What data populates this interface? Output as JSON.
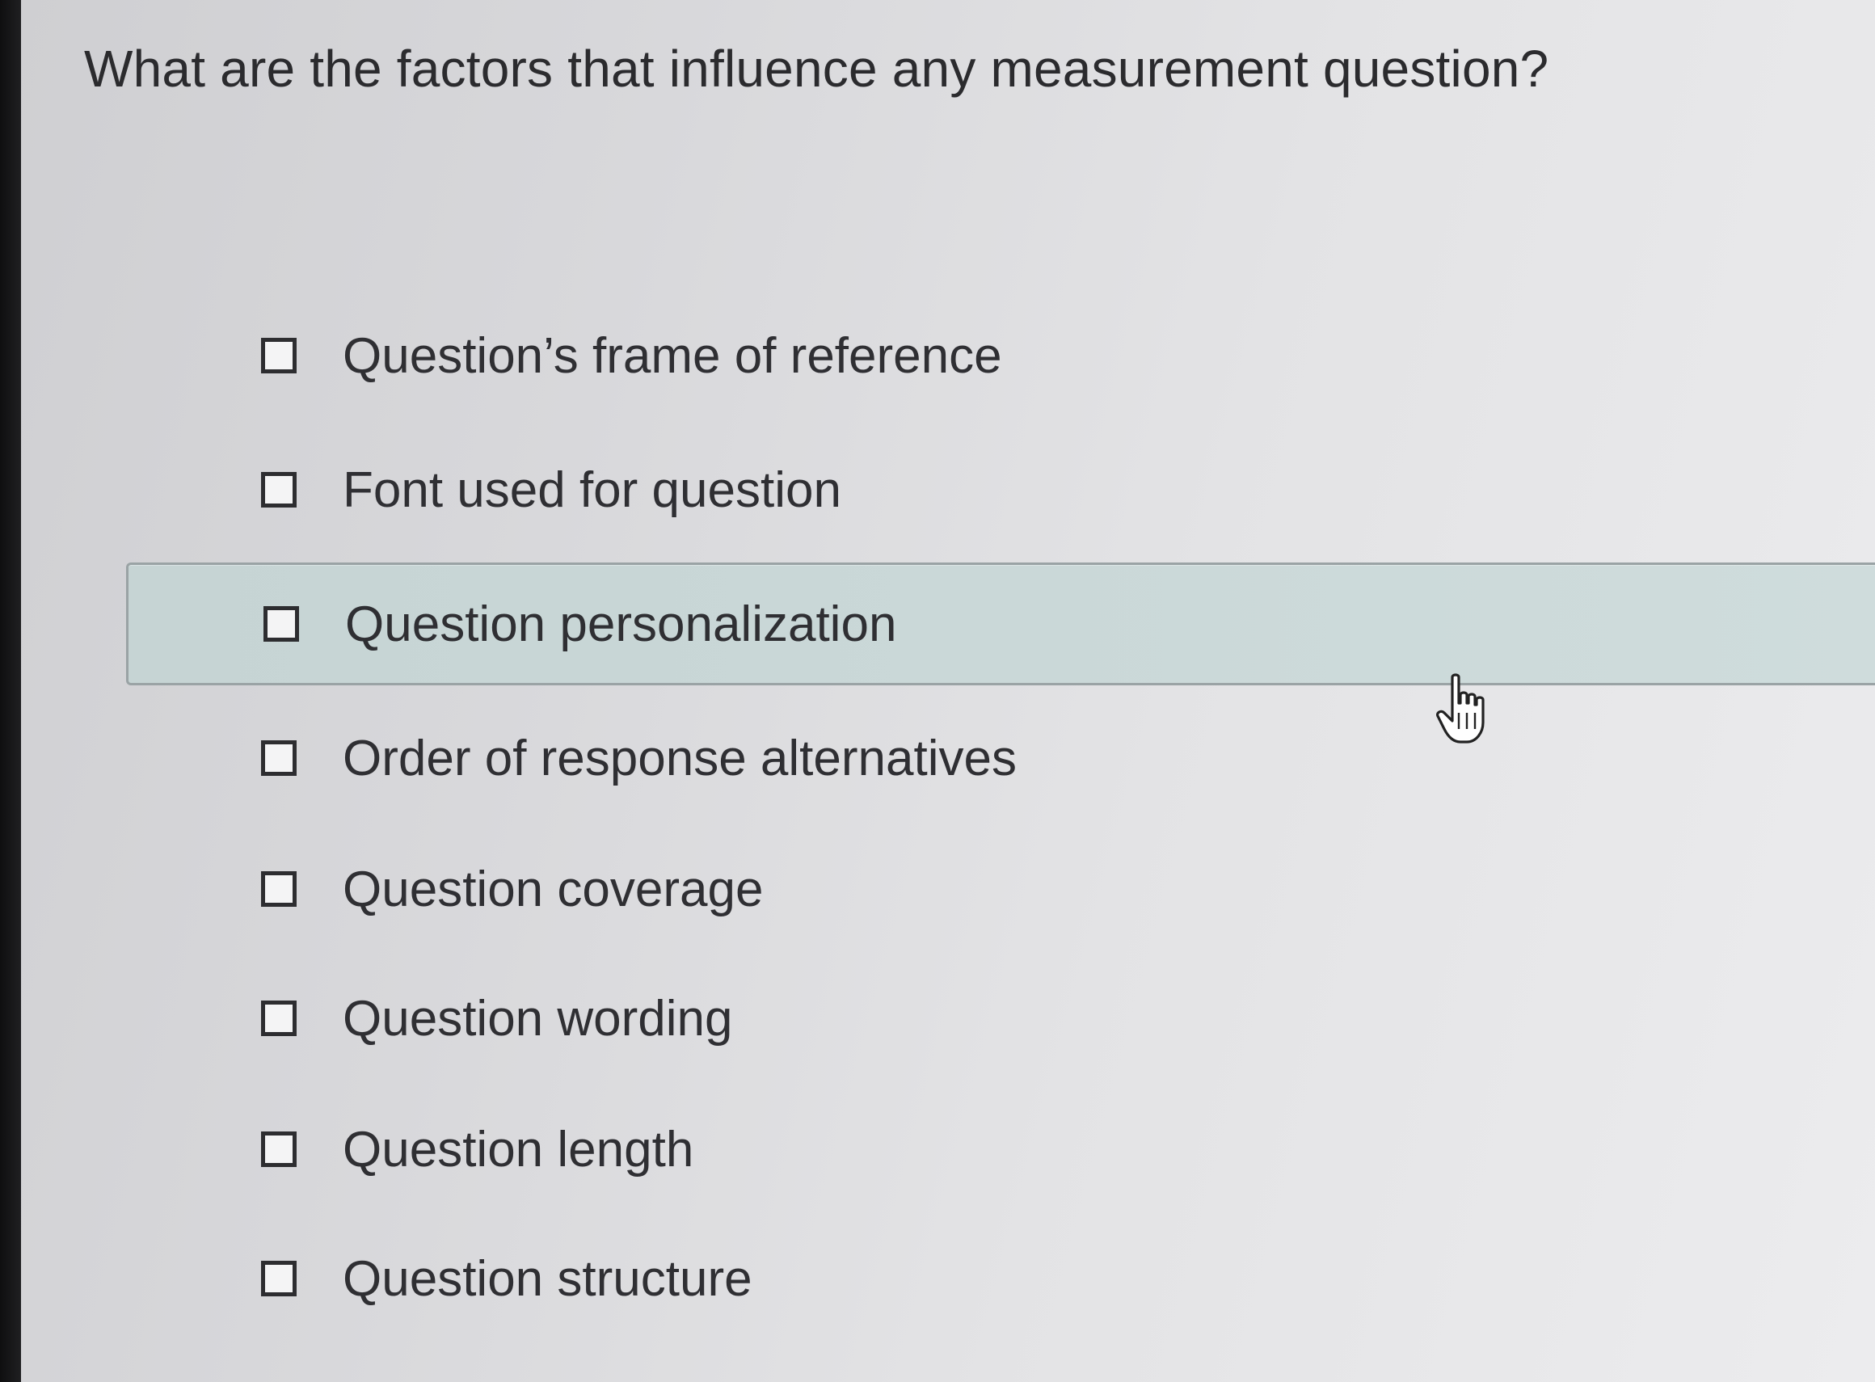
{
  "question": {
    "text": "What are the factors that influence any measurement question?"
  },
  "options": [
    {
      "label": "Question’s frame of reference",
      "checked": false,
      "highlighted": false
    },
    {
      "label": "Font used for question",
      "checked": false,
      "highlighted": false
    },
    {
      "label": "Question personalization",
      "checked": false,
      "highlighted": true
    },
    {
      "label": "Order of response alternatives",
      "checked": false,
      "highlighted": false
    },
    {
      "label": "Question coverage",
      "checked": false,
      "highlighted": false
    },
    {
      "label": "Question wording",
      "checked": false,
      "highlighted": false
    },
    {
      "label": "Question length",
      "checked": false,
      "highlighted": false
    },
    {
      "label": "Question structure",
      "checked": false,
      "highlighted": false
    }
  ],
  "cursor": {
    "icon": "hand-pointer-icon"
  },
  "colors": {
    "highlight": "#cad8d8",
    "text": "#2f2f33",
    "checkbox_border": "#2d2d30"
  }
}
